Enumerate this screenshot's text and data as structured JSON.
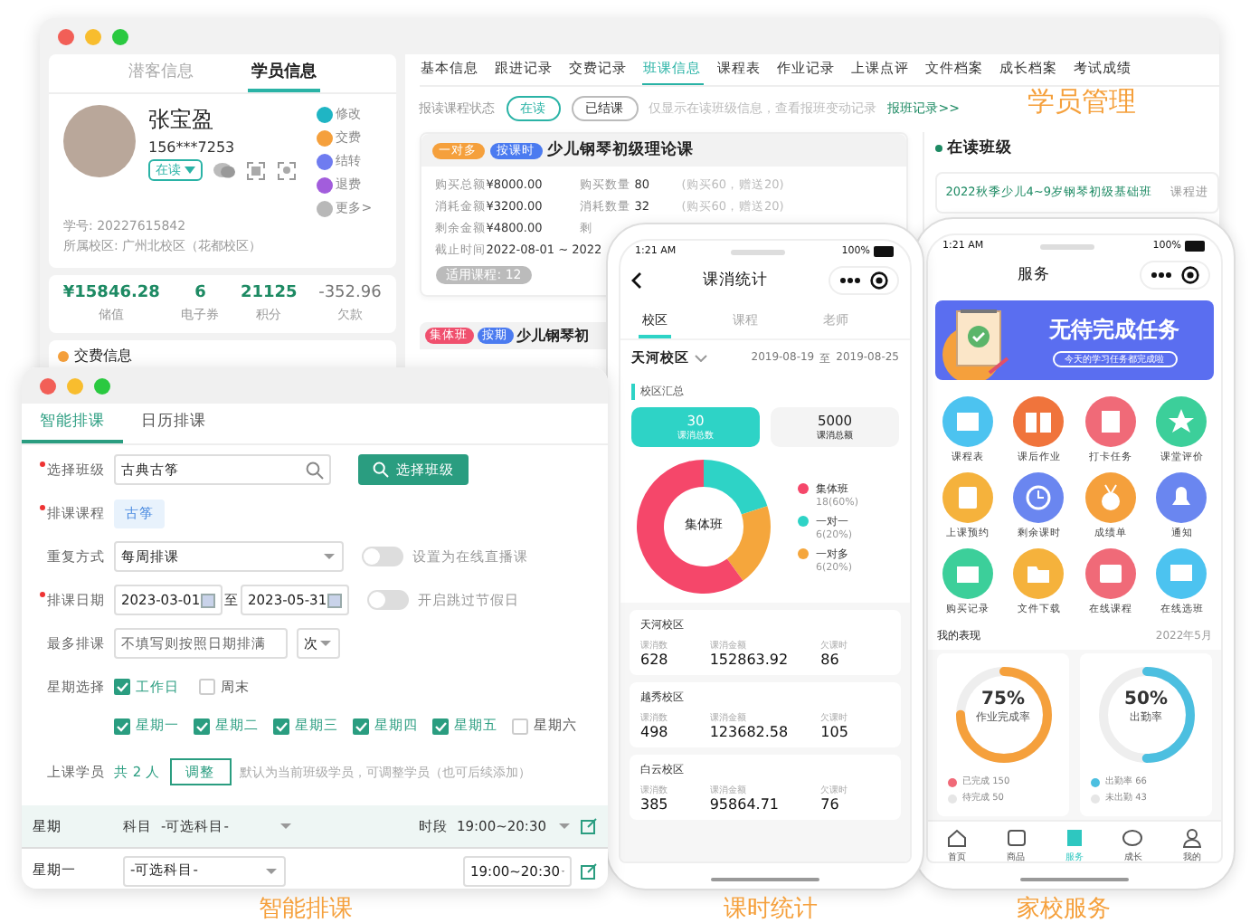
{
  "student_window": {
    "left_tabs": [
      {
        "label": "潜客信息",
        "selected": false
      },
      {
        "label": "学员信息",
        "selected": true
      }
    ],
    "profile": {
      "name": "张宝盈",
      "phone": "156***7253",
      "status": "在读",
      "student_no": "学号: 20227615842",
      "campus": "所属校区: 广州北校区（花都校区）"
    },
    "actions": [
      {
        "label": "修改",
        "color": "#1fb5c4"
      },
      {
        "label": "交费",
        "color": "#f5a03c"
      },
      {
        "label": "结转",
        "color": "#6f7cf0"
      },
      {
        "label": "退费",
        "color": "#a25ddc"
      },
      {
        "label": "更多>",
        "color": "#b8b8b8"
      }
    ],
    "stats": [
      {
        "value": "¥15846.28",
        "label": "储值",
        "kind": "positive"
      },
      {
        "value": "6",
        "label": "电子券",
        "kind": "positive"
      },
      {
        "value": "21125",
        "label": "积分",
        "kind": "positive"
      },
      {
        "value": "-352.96",
        "label": "欠款",
        "kind": "negative"
      }
    ],
    "fee_section": "交费信息",
    "right_tabs": [
      {
        "label": "基本信息",
        "selected": false
      },
      {
        "label": "跟进记录",
        "selected": false
      },
      {
        "label": "交费记录",
        "selected": false
      },
      {
        "label": "班课信息",
        "selected": true
      },
      {
        "label": "课程表",
        "selected": false
      },
      {
        "label": "作业记录",
        "selected": false
      },
      {
        "label": "上课点评",
        "selected": false
      },
      {
        "label": "文件档案",
        "selected": false
      },
      {
        "label": "成长档案",
        "selected": false
      },
      {
        "label": "考试成绩",
        "selected": false
      }
    ],
    "filter": {
      "label": "报读课程状态",
      "chips": [
        {
          "label": "在读",
          "selected": true
        },
        {
          "label": "已结课",
          "selected": false
        }
      ],
      "hint": "仅显示在读班级信息，查看报班变动记录",
      "link": "报班记录>>"
    },
    "courses": [
      {
        "tags": [
          {
            "label": "一对多",
            "color": "#f5a03c"
          },
          {
            "label": "按课时",
            "color": "#4b7bf0"
          }
        ],
        "title": "少儿钢琴初级理论课",
        "rows": [
          [
            "购买总额",
            "¥8000.00",
            "购买数量",
            "80",
            "(购买60，赠送20)"
          ],
          [
            "消耗金额",
            "¥3200.00",
            "消耗数量",
            "32",
            "(购买60，赠送20)"
          ],
          [
            "剩余金额",
            "¥4800.00",
            "剩"
          ],
          [
            "截止时间",
            "2022-08-01 ~ 2022"
          ]
        ],
        "pill": "适用课程: 12"
      },
      {
        "tags": [
          {
            "label": "集体班",
            "color": "#f0506e"
          },
          {
            "label": "按期",
            "color": "#4b7bf0"
          }
        ],
        "title": "少儿钢琴初"
      }
    ],
    "active_classes": {
      "title": "在读班级",
      "items": [
        {
          "name": "2022秋季少儿4~9岁钢琴初级基础班",
          "meta_1": "课程进"
        }
      ]
    }
  },
  "schedule_window": {
    "tabs": [
      {
        "label": "智能排课",
        "selected": true
      },
      {
        "label": "日历排课",
        "selected": false
      }
    ],
    "class_field": {
      "label": "选择班级",
      "required": true,
      "value": "古典古筝",
      "button": "选择班级"
    },
    "course": {
      "label": "排课课程",
      "required": true,
      "tag": "古筝"
    },
    "repeat": {
      "label": "重复方式",
      "required": false,
      "value": "每周排课",
      "toggle_label": "设置为在线直播课",
      "on": false
    },
    "dates": {
      "label": "排课日期",
      "required": true,
      "start": "2023-03-01",
      "separator": "至",
      "end": "2023-05-31",
      "toggle_label": "开启跳过节假日",
      "on": false
    },
    "max": {
      "label": "最多排课",
      "required": false,
      "placeholder": "不填写则按照日期排满",
      "unit": "次"
    },
    "week": {
      "label": "星期选择",
      "groups": [
        {
          "label": "工作日",
          "checked": true
        },
        {
          "label": "周末",
          "checked": false
        }
      ],
      "days": [
        {
          "label": "星期一",
          "checked": true
        },
        {
          "label": "星期二",
          "checked": true
        },
        {
          "label": "星期三",
          "checked": true
        },
        {
          "label": "星期四",
          "checked": true
        },
        {
          "label": "星期五",
          "checked": true
        },
        {
          "label": "星期六",
          "checked": false
        }
      ]
    },
    "students": {
      "label": "上课学员",
      "count": "共 2 人",
      "button": "调整",
      "hint": "默认为当前班级学员，可调整学员（也可后续添加）"
    },
    "table": {
      "header": {
        "weekday": "星期",
        "subject_label": "科目",
        "subject": "-可选科目-",
        "time_label": "时段",
        "time": "19:00~20:30"
      },
      "rows": [
        {
          "weekday": "星期一",
          "subject": "-可选科目-",
          "time": "19:00~20:30"
        }
      ]
    }
  },
  "stats_phone": {
    "time": "1:21 AM",
    "battery": "100%",
    "title": "课消统计",
    "tabs": [
      {
        "label": "校区",
        "selected": true
      },
      {
        "label": "课程",
        "selected": false
      },
      {
        "label": "老师",
        "selected": false
      }
    ],
    "campus": "天河校区",
    "date_from": "2019-08-19",
    "date_sep": "至",
    "date_to": "2019-08-25",
    "section": "校区汇总",
    "summary": [
      {
        "value": "30",
        "label": "课消总数",
        "selected": true
      },
      {
        "value": "5000",
        "label": "课消总额",
        "selected": false
      }
    ],
    "chart_data": {
      "type": "donut",
      "categories": [
        "集体班",
        "一对一",
        "一对多"
      ],
      "series": [
        {
          "values": [
            60,
            20,
            20
          ]
        }
      ]
    },
    "donut_center": "集体班",
    "legend": [
      {
        "detail": "18(60%)",
        "color": "#f5476a"
      },
      {
        "detail": "6(20%)",
        "color": "#2ed3c6"
      },
      {
        "detail": "6(20%)",
        "color": "#f5a63c"
      }
    ],
    "cards": [
      {
        "name": "天河校区",
        "cols": [
          {
            "label": "课消数",
            "value": "628"
          },
          {
            "label": "课消金额",
            "value": "152863.92"
          },
          {
            "label": "欠课时",
            "value": "86"
          }
        ]
      },
      {
        "name": "越秀校区",
        "cols": [
          {
            "label": "课消数",
            "value": "498"
          },
          {
            "label": "课消金额",
            "value": "123682.58"
          },
          {
            "label": "欠课时",
            "value": "105"
          }
        ]
      },
      {
        "name": "白云校区",
        "cols": [
          {
            "label": "课消数",
            "value": "385"
          },
          {
            "label": "课消金额",
            "value": "95864.71"
          },
          {
            "label": "欠课时",
            "value": "76"
          }
        ]
      }
    ]
  },
  "service_phone": {
    "time": "1:21 AM",
    "battery": "100%",
    "title": "服务",
    "banner_title": "无待完成任务",
    "banner_sub": "今天的学习任务都完成啦",
    "services": [
      "课程表",
      "课后作业",
      "打卡任务",
      "课堂评价",
      "上课预约",
      "剩余课时",
      "成绩单",
      "通知",
      "购买记录",
      "文件下载",
      "在线课程",
      "在线选班"
    ],
    "perf_title": "我的表现",
    "perf_month": "2022年5月",
    "rings": [
      {
        "percent": "75%",
        "caption": "作业完成率",
        "level": 0.75,
        "kind": "homework",
        "legend": [
          "已完成 150",
          "待完成 50"
        ]
      },
      {
        "percent": "50%",
        "caption": "出勤率",
        "level": 0.5,
        "kind": "attendance",
        "legend": [
          "出勤率 66",
          "未出勤 43"
        ]
      }
    ],
    "nav": [
      {
        "label": "首页",
        "selected": false
      },
      {
        "label": "商品",
        "selected": false
      },
      {
        "label": "服务",
        "selected": true
      },
      {
        "label": "成长",
        "selected": false
      },
      {
        "label": "我的",
        "selected": false
      }
    ]
  },
  "captions": [
    "学员管理",
    "智能排课",
    "课时统计",
    "家校服务"
  ]
}
